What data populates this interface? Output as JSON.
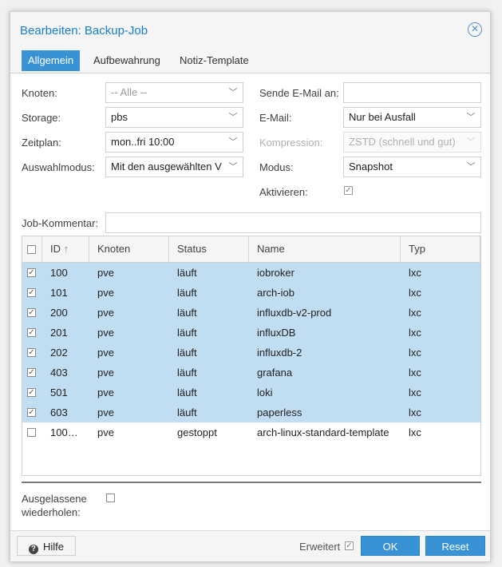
{
  "window": {
    "title": "Bearbeiten: Backup-Job"
  },
  "tabs": [
    "Allgemein",
    "Aufbewahrung",
    "Notiz-Template"
  ],
  "form": {
    "node_label": "Knoten:",
    "node_value": "-- Alle --",
    "storage_label": "Storage:",
    "storage_value": "pbs",
    "schedule_label": "Zeitplan:",
    "schedule_value": "mon..fri 10:00",
    "selection_label": "Auswahlmodus:",
    "selection_value": "Mit den ausgewählten V",
    "mailto_label": "Sende E-Mail an:",
    "mailto_value": "",
    "email_label": "E-Mail:",
    "email_value": "Nur bei Ausfall",
    "compression_label": "Kompression:",
    "compression_value": "ZSTD (schnell und gut)",
    "mode_label": "Modus:",
    "mode_value": "Snapshot",
    "enable_label": "Aktivieren:",
    "comment_label": "Job-Kommentar:",
    "comment_value": "",
    "repeat_label_1": "Ausgelassene",
    "repeat_label_2": "wiederholen:"
  },
  "grid": {
    "columns": [
      "ID",
      "Knoten",
      "Status",
      "Name",
      "Typ"
    ],
    "sort_indicator": "↑",
    "rows": [
      {
        "id": "100",
        "node": "pve",
        "status": "läuft",
        "name": "iobroker",
        "type": "lxc",
        "selected": true
      },
      {
        "id": "101",
        "node": "pve",
        "status": "läuft",
        "name": "arch-iob",
        "type": "lxc",
        "selected": true
      },
      {
        "id": "200",
        "node": "pve",
        "status": "läuft",
        "name": "influxdb-v2-prod",
        "type": "lxc",
        "selected": true
      },
      {
        "id": "201",
        "node": "pve",
        "status": "läuft",
        "name": "influxDB",
        "type": "lxc",
        "selected": true
      },
      {
        "id": "202",
        "node": "pve",
        "status": "läuft",
        "name": "influxdb-2",
        "type": "lxc",
        "selected": true
      },
      {
        "id": "403",
        "node": "pve",
        "status": "läuft",
        "name": "grafana",
        "type": "lxc",
        "selected": true
      },
      {
        "id": "501",
        "node": "pve",
        "status": "läuft",
        "name": "loki",
        "type": "lxc",
        "selected": true
      },
      {
        "id": "603",
        "node": "pve",
        "status": "läuft",
        "name": "paperless",
        "type": "lxc",
        "selected": true
      },
      {
        "id": "100…",
        "node": "pve",
        "status": "gestoppt",
        "name": "arch-linux-standard-template",
        "type": "lxc",
        "selected": false
      }
    ]
  },
  "footer": {
    "help": "Hilfe",
    "advanced": "Erweitert",
    "ok": "OK",
    "reset": "Reset"
  },
  "icons": {
    "close": "close-circle-icon",
    "help": "question-circle-icon",
    "dropdown": "chevron-down-icon"
  },
  "colors": {
    "accent": "#3892d4",
    "title": "#157fcc",
    "selected_row": "#c1ddf1"
  }
}
